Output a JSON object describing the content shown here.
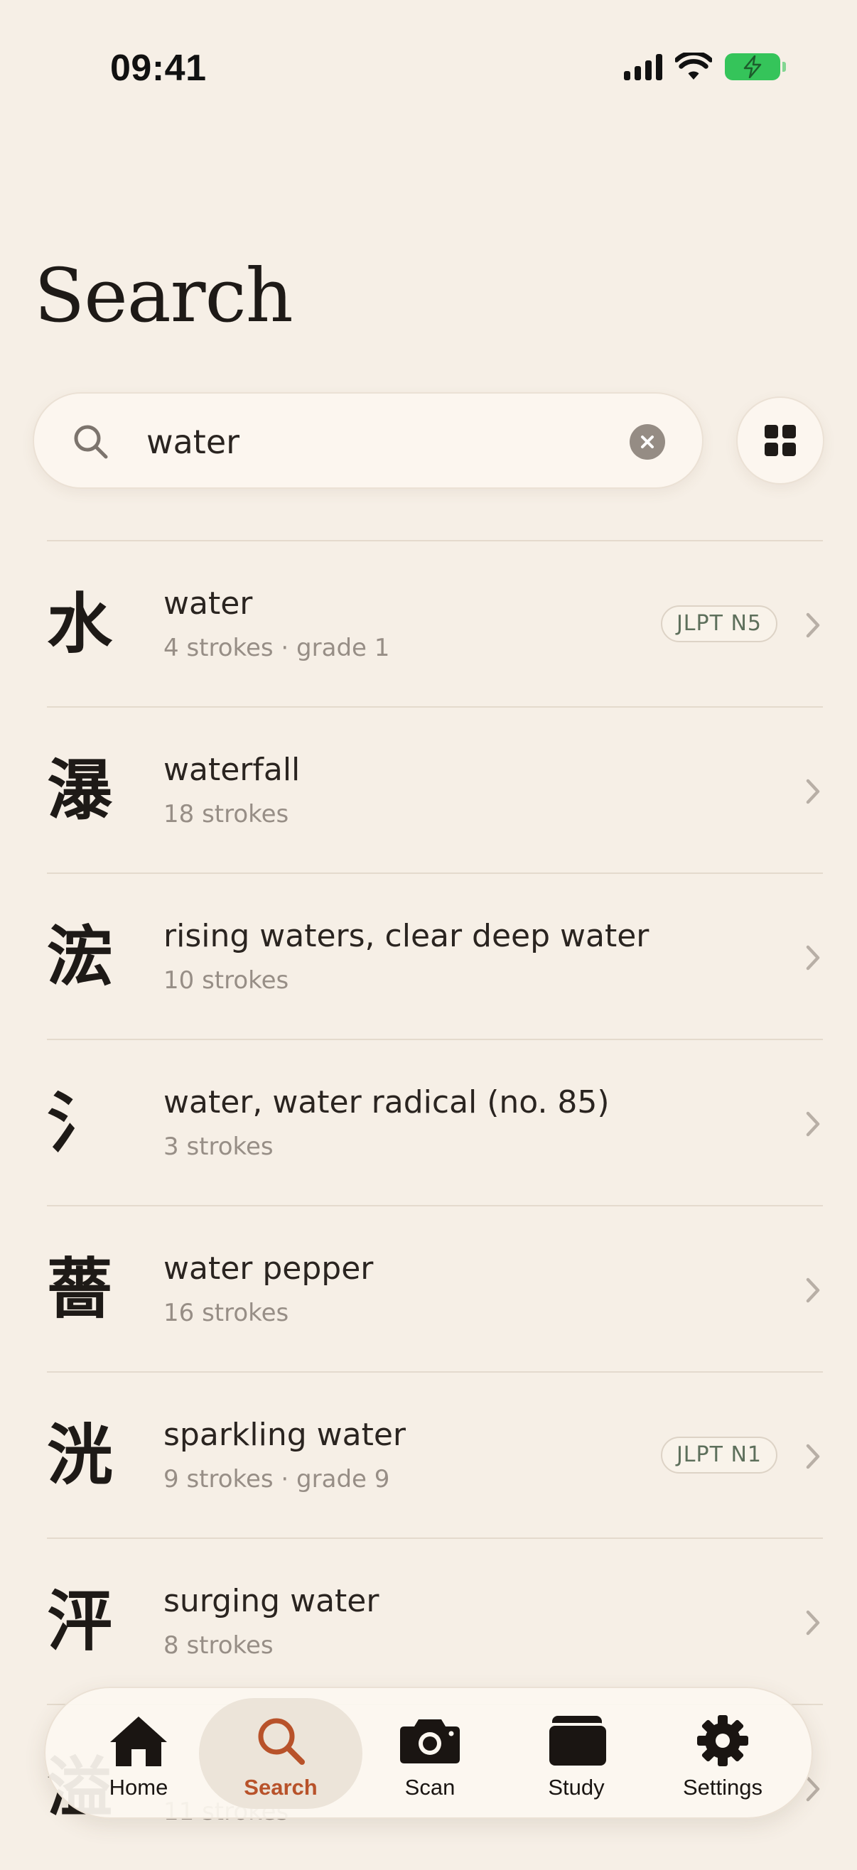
{
  "status_bar": {
    "time": "09:41"
  },
  "page": {
    "title": "Search"
  },
  "search": {
    "value": "water",
    "clear_icon": "close-icon",
    "view_toggle_icon": "grid-icon"
  },
  "results": [
    {
      "kanji": "水",
      "meaning": "water",
      "detail": "4 strokes · grade 1",
      "badge": "JLPT N5"
    },
    {
      "kanji": "瀑",
      "meaning": "waterfall",
      "detail": "18 strokes",
      "badge": ""
    },
    {
      "kanji": "浤",
      "meaning": "rising waters, clear deep water",
      "detail": "10 strokes",
      "badge": ""
    },
    {
      "kanji": "氵",
      "meaning": "water, water radical (no. 85)",
      "detail": "3 strokes",
      "badge": ""
    },
    {
      "kanji": "薔",
      "meaning": "water pepper",
      "detail": "16 strokes",
      "badge": ""
    },
    {
      "kanji": "洸",
      "meaning": "sparkling water",
      "detail": "9 strokes · grade 9",
      "badge": "JLPT N1"
    },
    {
      "kanji": "泙",
      "meaning": "surging water",
      "detail": "8 strokes",
      "badge": ""
    },
    {
      "kanji": "溢",
      "meaning": "",
      "detail": "11 strokes",
      "badge": ""
    }
  ],
  "tab_bar": {
    "tabs": [
      {
        "label": "Home",
        "icon": "home-icon",
        "active": false
      },
      {
        "label": "Search",
        "icon": "search-icon",
        "active": true
      },
      {
        "label": "Scan",
        "icon": "camera-icon",
        "active": false
      },
      {
        "label": "Study",
        "icon": "cards-icon",
        "active": false
      },
      {
        "label": "Settings",
        "icon": "gear-icon",
        "active": false
      }
    ]
  },
  "colors": {
    "background": "#f6efe6",
    "accent": "#b8522a",
    "battery": "#35c45a",
    "badge_text": "#5d6f5b",
    "secondary_text": "#978e86"
  }
}
